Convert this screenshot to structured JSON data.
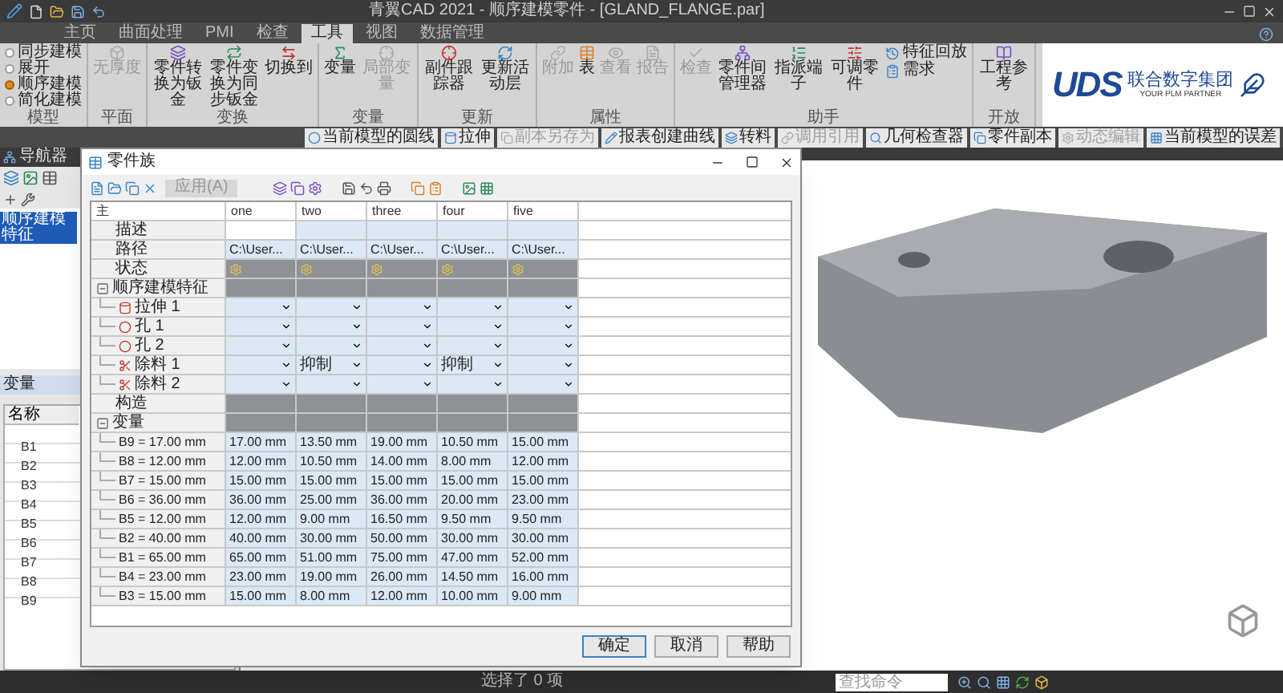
{
  "window": {
    "title": "青翼CAD 2021 - 顺序建模零件 - [GLAND_FLANGE.par]"
  },
  "ribbon": {
    "tabs": [
      {
        "label": "主页",
        "selected": false
      },
      {
        "label": "曲面处理",
        "selected": false
      },
      {
        "label": "PMI",
        "selected": false
      },
      {
        "label": "检查",
        "selected": false
      },
      {
        "label": "工具",
        "selected": true
      },
      {
        "label": "视图",
        "selected": false
      },
      {
        "label": "数据管理",
        "selected": false
      }
    ],
    "groups": [
      {
        "label": "模型",
        "kind": "radios",
        "options": [
          {
            "label": "同步建模",
            "selected": false
          },
          {
            "label": "展开",
            "selected": false
          },
          {
            "label": "顺序建模",
            "selected": true
          },
          {
            "label": "简化建模",
            "selected": false
          }
        ]
      },
      {
        "label": "平面",
        "kind": "buttons",
        "buttons": [
          {
            "label": "无厚度",
            "kind": "large",
            "disabled": true
          }
        ]
      },
      {
        "label": "变换",
        "kind": "buttons",
        "buttons": [
          {
            "label": "零件转换为钣金",
            "kind": "large",
            "disabled": false
          },
          {
            "label": "零件变换为同步钣金",
            "kind": "large",
            "disabled": false
          },
          {
            "label": "切换到",
            "kind": "large",
            "disabled": false
          }
        ]
      },
      {
        "label": "变量",
        "kind": "buttons",
        "buttons": [
          {
            "label": "变量",
            "kind": "large",
            "disabled": false
          },
          {
            "label": "局部变量",
            "kind": "large",
            "disabled": true
          }
        ]
      },
      {
        "label": "更新",
        "kind": "buttons",
        "buttons": [
          {
            "label": "副件跟踪器",
            "kind": "large",
            "disabled": false
          },
          {
            "label": "更新活动层",
            "kind": "large",
            "disabled": false
          }
        ]
      },
      {
        "label": "属性",
        "kind": "buttons",
        "buttons": [
          {
            "label": "附加",
            "kind": "large",
            "disabled": true
          },
          {
            "label": "表",
            "kind": "large",
            "disabled": false
          },
          {
            "label": "查看",
            "kind": "large",
            "disabled": true
          },
          {
            "label": "报告",
            "kind": "large",
            "disabled": true
          }
        ]
      },
      {
        "label": "助手",
        "kind": "buttons",
        "buttons": [
          {
            "label": "检查",
            "kind": "large",
            "disabled": true
          },
          {
            "label": "零件间管理器",
            "kind": "large",
            "disabled": false
          },
          {
            "label": "指派端子",
            "kind": "large",
            "disabled": false
          },
          {
            "label": "可调零件",
            "kind": "large",
            "disabled": false
          },
          {
            "label": "特征回放",
            "kind": "small",
            "disabled": false
          },
          {
            "label": "需求",
            "kind": "small",
            "disabled": false
          }
        ]
      },
      {
        "label": "开放",
        "kind": "buttons",
        "buttons": [
          {
            "label": "工程参考",
            "kind": "large",
            "disabled": false
          }
        ]
      }
    ]
  },
  "logo": {
    "brand": "UDS",
    "name": "联合数字集团",
    "tagline": "YOUR PLM PARTNER"
  },
  "toolbar": {
    "items": [
      {
        "label": "当前模型的圆线",
        "disabled": false
      },
      {
        "label": "拉伸",
        "disabled": false
      },
      {
        "label": "副本另存为",
        "disabled": true
      },
      {
        "label": "报表创建曲线",
        "disabled": false
      },
      {
        "label": "转料",
        "disabled": false
      },
      {
        "label": "调用引用",
        "disabled": true
      },
      {
        "label": "几何检查器",
        "disabled": false
      },
      {
        "label": "零件副本",
        "disabled": false
      },
      {
        "label": "动态编辑",
        "disabled": true
      },
      {
        "label": "当前模型的误差",
        "disabled": false
      }
    ]
  },
  "navigator": {
    "title": "导航器",
    "items": [
      {
        "label": "顺序建模特征",
        "selected": true
      }
    ]
  },
  "variables_panel": {
    "title": "变量",
    "column": "名称",
    "rows": [
      "B1",
      "B2",
      "B3",
      "B4",
      "B5",
      "B6",
      "B7",
      "B8",
      "B9"
    ]
  },
  "part_table": {
    "title": "零件族",
    "apply_button": {
      "label": "应用(A)",
      "disabled": true
    },
    "columns": [
      "主",
      "one",
      "two",
      "three",
      "four",
      "five"
    ],
    "rows": [
      {
        "kind": "blank",
        "label": "描述"
      },
      {
        "kind": "text",
        "label": "路径",
        "cells": [
          "C:\\User...",
          "C:\\User...",
          "C:\\User...",
          "C:\\User...",
          "C:\\User..."
        ]
      },
      {
        "kind": "status",
        "label": "状态"
      },
      {
        "kind": "group",
        "label": "顺序建模特征",
        "expanded": true,
        "children": [
          {
            "kind": "extrude",
            "label": "拉伸 1",
            "cells": [
              {},
              {},
              {},
              {},
              {}
            ]
          },
          {
            "kind": "hole",
            "label": "孔 1",
            "cells": [
              {},
              {},
              {},
              {},
              {}
            ]
          },
          {
            "kind": "hole",
            "label": "孔 2",
            "cells": [
              {},
              {},
              {},
              {},
              {}
            ]
          },
          {
            "kind": "cut",
            "label": "除料 1",
            "cells": [
              {},
              {
                "value": "抑制"
              },
              {},
              {
                "value": "抑制"
              },
              {}
            ]
          },
          {
            "kind": "cut",
            "label": "除料 2",
            "cells": [
              {},
              {},
              {},
              {},
              {}
            ]
          }
        ]
      },
      {
        "kind": "section",
        "label": "构造"
      },
      {
        "kind": "group",
        "label": "变量",
        "expanded": true,
        "children": [
          {
            "kind": "value",
            "label": "B9 = 17.00 mm",
            "cells": [
              "17.00 mm",
              "13.50 mm",
              "19.00 mm",
              "10.50 mm",
              "15.00 mm"
            ]
          },
          {
            "kind": "value",
            "label": "B8 = 12.00 mm",
            "cells": [
              "12.00 mm",
              "10.50 mm",
              "14.00 mm",
              "8.00 mm",
              "12.00 mm"
            ]
          },
          {
            "kind": "value",
            "label": "B7 = 15.00 mm",
            "cells": [
              "15.00 mm",
              "15.00 mm",
              "15.00 mm",
              "15.00 mm",
              "15.00 mm"
            ]
          },
          {
            "kind": "value",
            "label": "B6 = 36.00 mm",
            "cells": [
              "36.00 mm",
              "25.00 mm",
              "36.00 mm",
              "20.00 mm",
              "23.00 mm"
            ]
          },
          {
            "kind": "value",
            "label": "B5 = 12.00 mm",
            "cells": [
              "12.00 mm",
              "9.00 mm",
              "16.50 mm",
              "9.50 mm",
              "9.50 mm"
            ]
          },
          {
            "kind": "value",
            "label": "B2 = 40.00 mm",
            "cells": [
              "40.00 mm",
              "30.00 mm",
              "50.00 mm",
              "30.00 mm",
              "30.00 mm"
            ]
          },
          {
            "kind": "value",
            "label": "B1 = 65.00 mm",
            "cells": [
              "65.00 mm",
              "51.00 mm",
              "75.00 mm",
              "47.00 mm",
              "52.00 mm"
            ]
          },
          {
            "kind": "value",
            "label": "B4 = 23.00 mm",
            "cells": [
              "23.00 mm",
              "19.00 mm",
              "26.00 mm",
              "14.50 mm",
              "16.00 mm"
            ]
          },
          {
            "kind": "value",
            "label": "B3 = 15.00 mm",
            "cells": [
              "15.00 mm",
              "8.00 mm",
              "12.00 mm",
              "10.00 mm",
              "9.00 mm"
            ]
          }
        ]
      }
    ],
    "buttons": [
      {
        "label": "确定",
        "default": true
      },
      {
        "label": "取消",
        "default": false
      },
      {
        "label": "帮助",
        "default": false
      }
    ]
  },
  "status_bar": {
    "text": "选择了 0 项",
    "search": {
      "placeholder": "查找命令"
    }
  }
}
